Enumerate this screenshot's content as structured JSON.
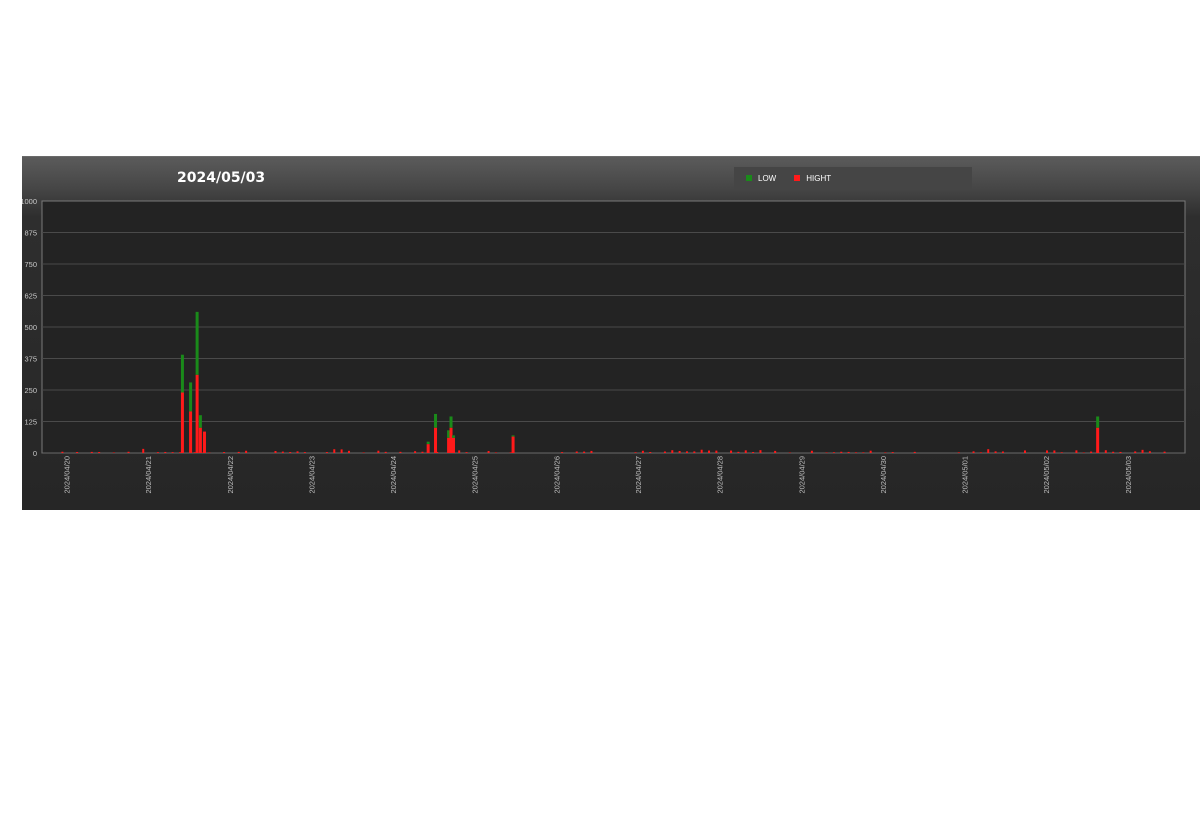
{
  "chart_data": {
    "type": "bar",
    "title": "2024/05/03",
    "stacked": true,
    "ylim": [
      0,
      1000
    ],
    "yticks": [
      "0",
      "125",
      "250",
      "375",
      "500",
      "625",
      "750",
      "875",
      "1000"
    ],
    "x_dates": [
      "2024/04/20",
      "2024/04/21",
      "2024/04/22",
      "2024/04/23",
      "2024/04/24",
      "2024/04/25",
      "2024/04/26",
      "2024/04/27",
      "2024/04/28",
      "2024/04/29",
      "2024/04/30",
      "2024/05/01",
      "2024/05/02",
      "2024/05/03"
    ],
    "x_range_days": [
      -0.3,
      13.7
    ],
    "legend_position": "top",
    "grid": true,
    "series": [
      {
        "name": "LOW",
        "color": "#1a8a1a"
      },
      {
        "name": "HIGHT",
        "color": "#ff1a1a"
      }
    ],
    "points": [
      {
        "d": 1.42,
        "low": 150,
        "high": 240
      },
      {
        "d": 1.52,
        "low": 115,
        "high": 165
      },
      {
        "d": 1.6,
        "low": 250,
        "high": 310
      },
      {
        "d": 1.64,
        "low": 50,
        "high": 100
      },
      {
        "d": 1.69,
        "low": 0,
        "high": 85
      },
      {
        "d": 4.43,
        "low": 10,
        "high": 35
      },
      {
        "d": 4.52,
        "low": 55,
        "high": 100
      },
      {
        "d": 4.68,
        "low": 30,
        "high": 60
      },
      {
        "d": 4.71,
        "low": 45,
        "high": 100
      },
      {
        "d": 4.74,
        "low": 10,
        "high": 60
      },
      {
        "d": 5.47,
        "low": 5,
        "high": 65
      },
      {
        "d": 12.63,
        "low": 45,
        "high": 100
      }
    ],
    "noise_level": "small values under 20 across the full range"
  },
  "legend": {
    "low_label": "LOW",
    "high_label": "HIGHT"
  },
  "colors": {
    "low": "#1a8a1a",
    "high": "#ff1a1a",
    "grid": "#4a4a4a",
    "plot_bg": "#232323"
  }
}
